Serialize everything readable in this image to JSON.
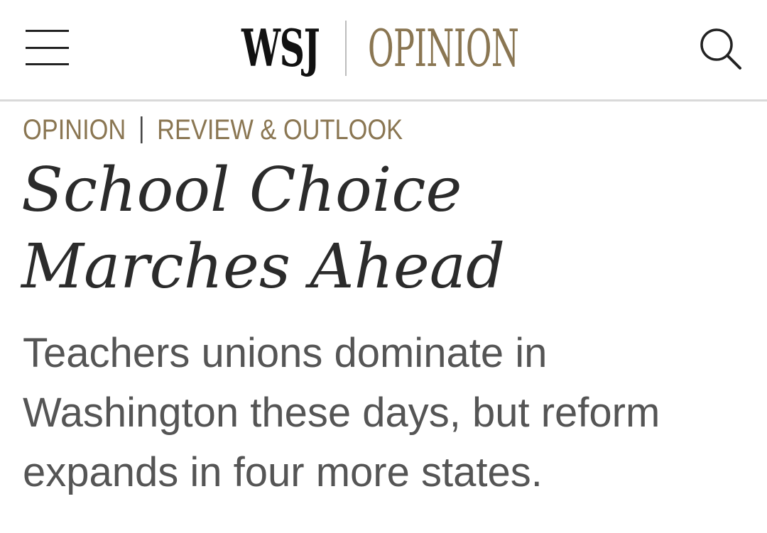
{
  "header": {
    "logo_primary": "WSJ",
    "logo_secondary": "OPINION",
    "menu_icon": "hamburger-menu-icon",
    "search_icon": "search-icon"
  },
  "breadcrumb": {
    "section": "OPINION",
    "subsection": "REVIEW & OUTLOOK"
  },
  "article": {
    "headline_line1": "School Choice",
    "headline_line2": "Marches Ahead",
    "dek": "Teachers unions dominate in Washington these days, but reform expands in four more states."
  },
  "colors": {
    "accent_gold": "#8a7652",
    "headline_text": "#2b2b2b",
    "dek_text": "#555555",
    "divider": "#d9d9d9"
  }
}
